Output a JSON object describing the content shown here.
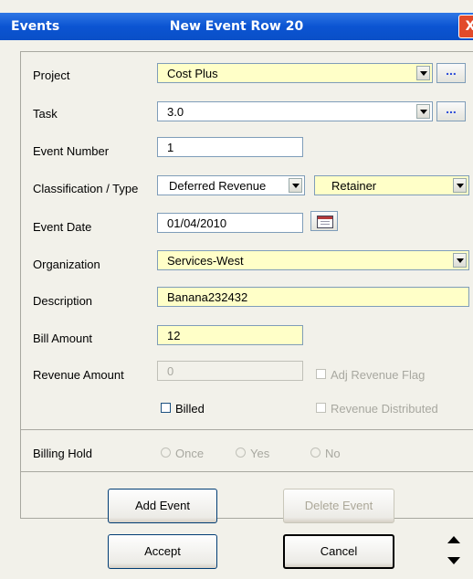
{
  "window": {
    "app_title": "Events",
    "title": "New Event Row 20",
    "close_glyph": "X"
  },
  "form": {
    "project": {
      "label": "Project",
      "value": "Cost Plus",
      "lookup": "..."
    },
    "task": {
      "label": "Task",
      "value": "3.0",
      "lookup": "..."
    },
    "event_number": {
      "label": "Event Number",
      "value": "1"
    },
    "classification": {
      "label": "Classification / Type",
      "classification_value": "Deferred Revenue",
      "type_value": "Retainer"
    },
    "event_date": {
      "label": "Event Date",
      "value": "01/04/2010"
    },
    "organization": {
      "label": "Organization",
      "value": "Services-West"
    },
    "description": {
      "label": "Description",
      "value": "Banana232432"
    },
    "bill_amount": {
      "label": "Bill Amount",
      "value": "12"
    },
    "revenue_amount": {
      "label": "Revenue Amount",
      "value": "0"
    },
    "adj_revenue_flag": {
      "label": "Adj Revenue Flag"
    },
    "billed": {
      "label": "Billed"
    },
    "revenue_distributed": {
      "label": "Revenue Distributed"
    }
  },
  "billing_hold": {
    "label": "Billing Hold",
    "options": [
      "Once",
      "Yes",
      "No"
    ]
  },
  "buttons": {
    "add_event": "Add Event",
    "delete_event": "Delete Event",
    "accept": "Accept",
    "cancel": "Cancel"
  },
  "icons": {
    "calendar": "calendar-icon",
    "scroll_up": "scroll-up-arrow",
    "scroll_down": "scroll-down-arrow"
  }
}
